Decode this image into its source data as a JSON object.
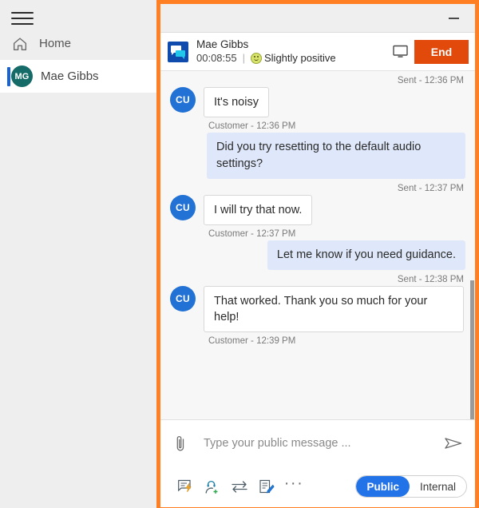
{
  "sidebar": {
    "menu_icon": "hamburger-icon",
    "items": [
      {
        "label": "Home",
        "icon": "home-icon",
        "selected": false
      },
      {
        "label": "Mae Gibbs",
        "icon": "avatar",
        "initials": "MG",
        "selected": true
      }
    ]
  },
  "window": {
    "minimize_label": "—"
  },
  "header": {
    "icon": "conversation-icon",
    "name": "Mae Gibbs",
    "timer": "00:08:55",
    "divider": "|",
    "sentiment_icon": "slightly-positive-emoji",
    "sentiment": "Slightly positive",
    "monitor_icon": "monitor-icon",
    "end_label": "End"
  },
  "messages": [
    {
      "kind": "meta-right",
      "text": "Sent - 12:36 PM"
    },
    {
      "kind": "in",
      "avatar": "CU",
      "text": "It's noisy",
      "meta": "Customer - 12:36 PM"
    },
    {
      "kind": "out",
      "text": "Did you try resetting to the default audio settings?",
      "meta": "Sent - 12:37 PM"
    },
    {
      "kind": "in",
      "avatar": "CU",
      "text": "I will try that now.",
      "meta": "Customer - 12:37 PM"
    },
    {
      "kind": "out",
      "text": "Let me know if you need guidance.",
      "meta": "Sent - 12:38 PM"
    },
    {
      "kind": "in",
      "avatar": "CU",
      "text": "That worked. Thank you so much for your help!",
      "meta": "Customer - 12:39 PM"
    }
  ],
  "composer": {
    "attach_icon": "paperclip-icon",
    "input_value": "",
    "placeholder": "Type your public message ...",
    "send_icon": "send-icon",
    "tools": [
      {
        "icon": "quick-reply-icon"
      },
      {
        "icon": "add-agent-icon"
      },
      {
        "icon": "transfer-icon"
      },
      {
        "icon": "note-icon"
      },
      {
        "icon": "more-options-icon",
        "label": "···"
      }
    ],
    "visibility": {
      "options": [
        "Public",
        "Internal"
      ],
      "selected": "Public"
    }
  },
  "colors": {
    "frame_orange": "#ff7f22",
    "end_button": "#e24a0c",
    "accent_blue": "#2272e8",
    "avatar_teal": "#146b68",
    "bubble_out": "#dfe8fa"
  }
}
